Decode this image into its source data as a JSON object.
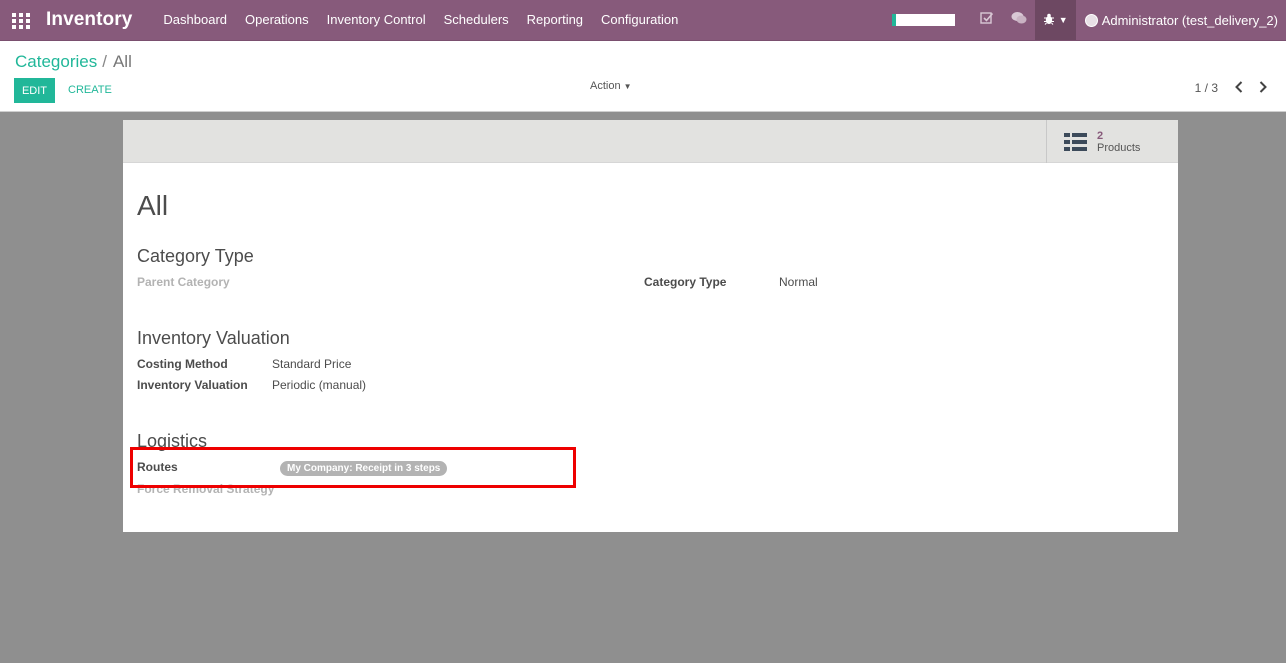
{
  "navbar": {
    "app_title": "Inventory",
    "menu": [
      "Dashboard",
      "Operations",
      "Inventory Control",
      "Schedulers",
      "Reporting",
      "Configuration"
    ],
    "user_name": "Administrator (test_delivery_2)"
  },
  "control_panel": {
    "breadcrumb_parent": "Categories",
    "breadcrumb_separator": "/",
    "breadcrumb_current": "All",
    "edit_label": "EDIT",
    "create_label": "CREATE",
    "action_label": "Action",
    "pager": "1 / 3"
  },
  "smart_button": {
    "count": "2",
    "label": "Products"
  },
  "form": {
    "title": "All",
    "category_type_section": "Category Type",
    "parent_category_label": "Parent Category",
    "category_type_label": "Category Type",
    "category_type_value": "Normal",
    "inventory_valuation_section": "Inventory Valuation",
    "costing_method_label": "Costing Method",
    "costing_method_value": "Standard Price",
    "inventory_valuation_label": "Inventory Valuation",
    "inventory_valuation_value": "Periodic (manual)",
    "logistics_section": "Logistics",
    "routes_label": "Routes",
    "routes_tag": "My Company: Receipt in 3 steps",
    "force_removal_label": "Force Removal Strategy"
  },
  "colors": {
    "navbar": "#875a7b",
    "accent": "#21b799",
    "highlight_box": "#ee0000"
  }
}
